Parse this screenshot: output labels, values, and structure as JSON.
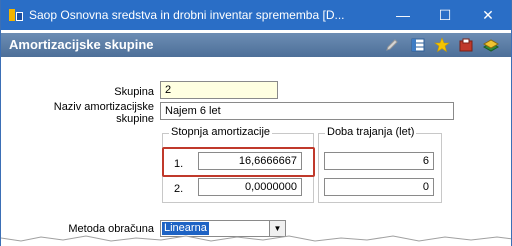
{
  "window": {
    "title": "Saop Osnovna sredstva in drobni inventar sprememba [D...",
    "minimize_glyph": "—",
    "maximize_glyph": "☐",
    "close_glyph": "✕"
  },
  "header": {
    "title": "Amortizacijske skupine",
    "toolbar_icons": [
      "pencil-icon",
      "grid-icon",
      "star-icon",
      "box-icon",
      "book-icon"
    ]
  },
  "form": {
    "skupina_label": "Skupina",
    "skupina_value": "2",
    "naziv_label_line1": "Naziv amortizacijske",
    "naziv_label_line2": "skupine",
    "naziv_value": "Najem 6 let",
    "stopnja_group_title": "Stopnja amortizacije",
    "doba_group_title": "Doba trajanja (let)",
    "rows": [
      {
        "num": "1.",
        "stopnja": "16,6666667",
        "doba": "6"
      },
      {
        "num": "2.",
        "stopnja": "0,0000000",
        "doba": "0"
      }
    ],
    "metoda_label": "Metoda obračuna",
    "metoda_value": "Linearna"
  },
  "colors": {
    "titlebar": "#2a6ec6",
    "header": "#5a7ca6",
    "highlight": "#c0392b",
    "selection": "#1e63c4"
  }
}
